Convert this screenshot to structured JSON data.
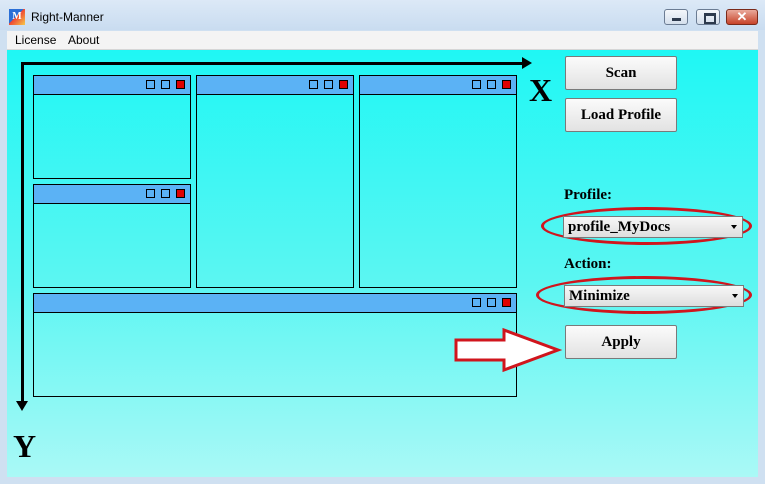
{
  "window": {
    "title": "Right-Manner",
    "icon_name": "app-logo-icon",
    "icon_letter": "M",
    "close_glyph": "✕"
  },
  "menu": {
    "items": [
      {
        "label": "License"
      },
      {
        "label": "About"
      }
    ]
  },
  "diagram": {
    "x_axis_label": "X",
    "y_axis_label": "Y",
    "window_bar_color": "#5bb2f5",
    "close_square_color": "#e00000",
    "background_top_color": "#1ff7f4",
    "background_bottom_color": "#aaf9f6"
  },
  "panel": {
    "scan_label": "Scan",
    "load_profile_label": "Load Profile",
    "profile_label": "Profile:",
    "profile_value": "profile_MyDocs",
    "action_label": "Action:",
    "action_value": "Minimize",
    "apply_label": "Apply",
    "highlight_color": "#d0151d"
  }
}
